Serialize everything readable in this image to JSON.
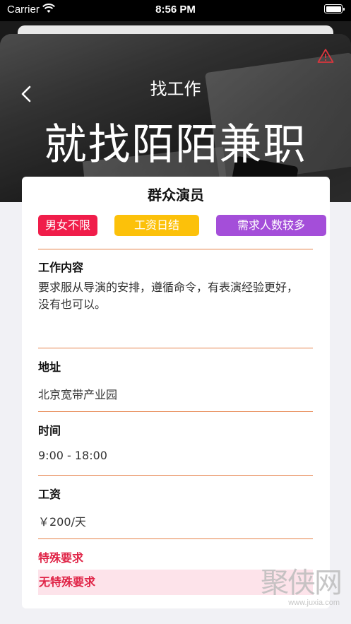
{
  "status_bar": {
    "carrier": "Carrier",
    "time": "8:56 PM"
  },
  "header": {
    "nav_title": "找工作",
    "hero_title": "就找陌陌兼职",
    "icons": {
      "back": "chevron-left-icon",
      "report": "warning-triangle-icon"
    },
    "colors": {
      "report_icon": "#d9363e"
    }
  },
  "job": {
    "title": "群众演员",
    "tags": [
      {
        "label": "男女不限",
        "color": "#f01d4a"
      },
      {
        "label": "工资日结",
        "color": "#fcc10a"
      },
      {
        "label": "需求人数较多",
        "color": "#a44ed9"
      }
    ],
    "sections": {
      "content": {
        "label": "工作内容",
        "value": "要求服从导演的安排，遵循命令，有表演经验更好，没有也可以。"
      },
      "address": {
        "label": "地址",
        "value": "北京宽带产业园"
      },
      "time": {
        "label": "时间",
        "value": "9:00 - 18:00"
      },
      "salary": {
        "label": "工资",
        "value": "￥200/天"
      },
      "special": {
        "label": "特殊要求",
        "value": "无特殊要求"
      }
    },
    "colors": {
      "divider": "#e6824a",
      "special_text": "#e02447",
      "special_bg": "#fde3ea"
    }
  },
  "watermark": {
    "main": "聚侠网",
    "url": "www.juxia.com"
  }
}
